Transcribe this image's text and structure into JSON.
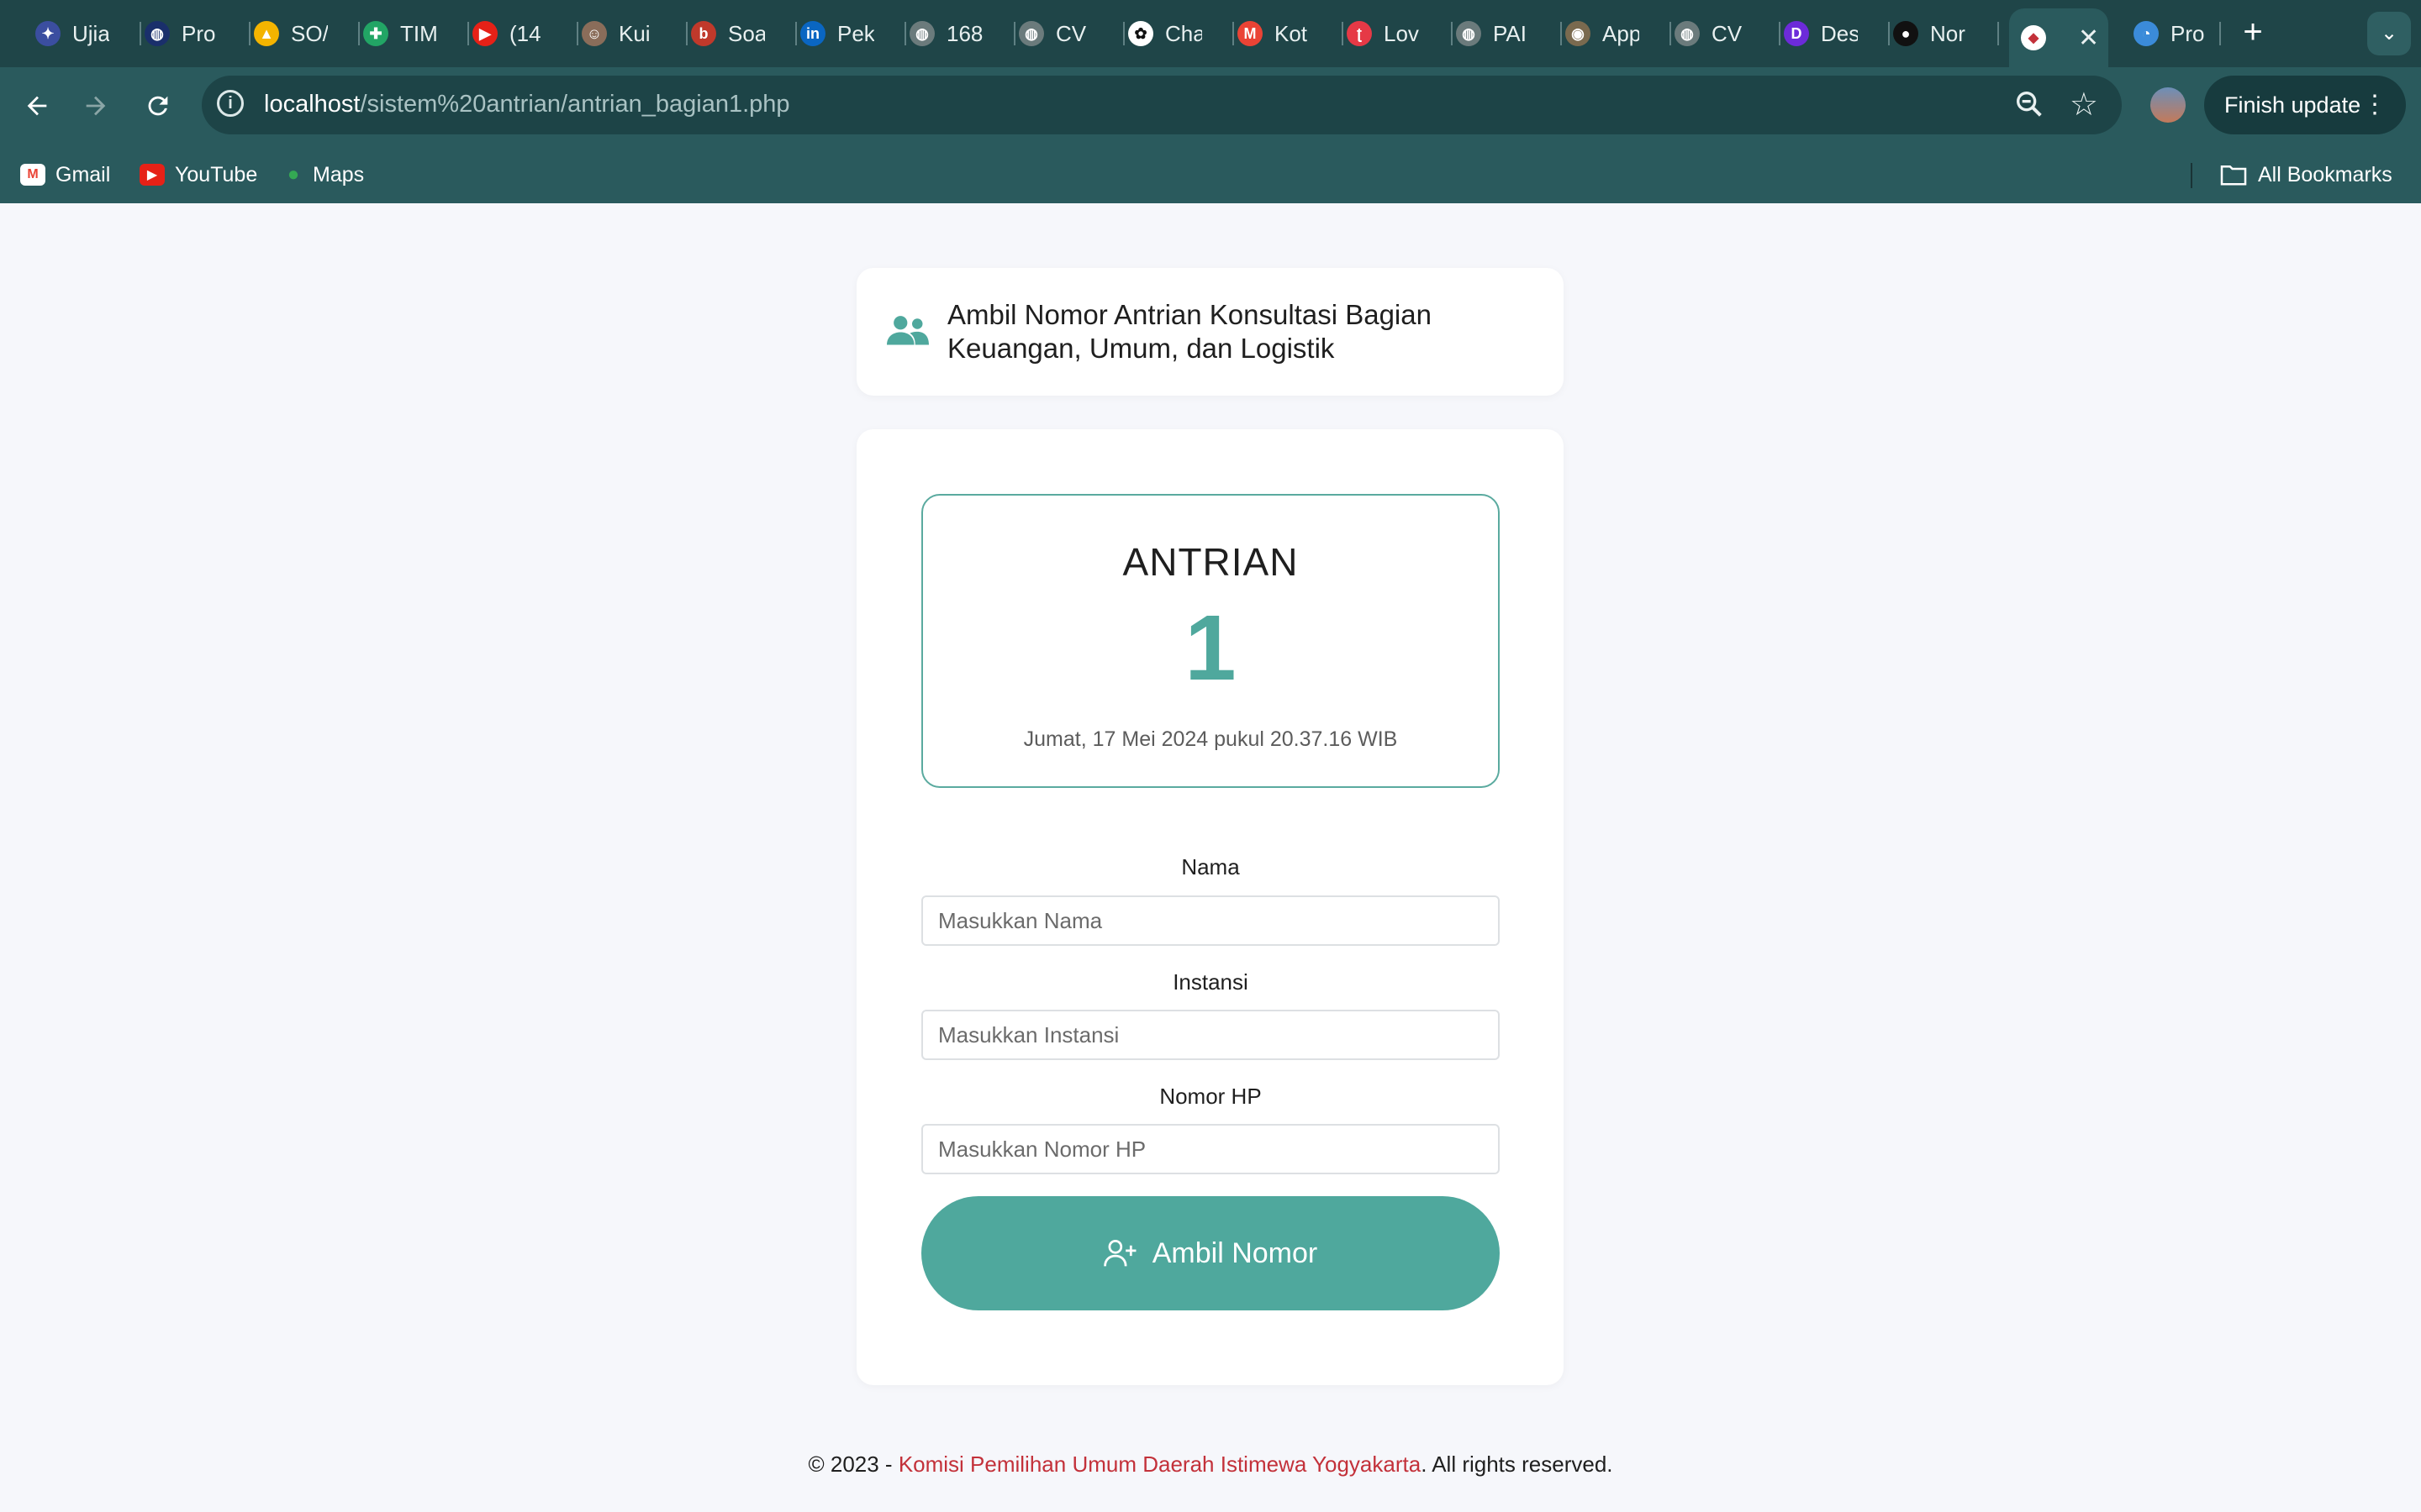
{
  "browser": {
    "tabs": [
      {
        "title": "Ujia",
        "icon": "university-icon",
        "color": "#3b4ea0"
      },
      {
        "title": "Pro",
        "icon": "globe-icon",
        "color": "#1a2f6b"
      },
      {
        "title": "SO/",
        "icon": "drive-icon",
        "color": "#f4b400"
      },
      {
        "title": "TIM",
        "icon": "sheets-icon",
        "color": "#22a565"
      },
      {
        "title": "(14",
        "icon": "youtube-icon",
        "color": "#e62117"
      },
      {
        "title": "Kui",
        "icon": "quiz-icon",
        "color": "#8a6d5a"
      },
      {
        "title": "Soa",
        "icon": "bb-icon",
        "color": "#c0392b"
      },
      {
        "title": "Pek",
        "icon": "linkedin-icon",
        "color": "#0a66c2"
      },
      {
        "title": "168",
        "icon": "globe-icon",
        "color": "#6b7b7c"
      },
      {
        "title": "CV",
        "icon": "globe-icon",
        "color": "#6b7b7c"
      },
      {
        "title": "Cha",
        "icon": "chatgpt-icon",
        "color": "#ffffff"
      },
      {
        "title": "Kot",
        "icon": "gmail-icon",
        "color": "#ea4335"
      },
      {
        "title": "Lov",
        "icon": "tinder-icon",
        "color": "#e63946"
      },
      {
        "title": "PAI",
        "icon": "globe-icon",
        "color": "#6b7b7c"
      },
      {
        "title": "App",
        "icon": "seal-icon",
        "color": "#7a6a4f"
      },
      {
        "title": "CV",
        "icon": "globe-icon",
        "color": "#6b7b7c"
      },
      {
        "title": "Des",
        "icon": "dealls-icon",
        "color": "#6c2bd9"
      },
      {
        "title": "Nor",
        "icon": "record-icon",
        "color": "#111111"
      }
    ],
    "active_tab": {
      "icon": "kpu-icon",
      "close": "✕"
    },
    "after_tab": {
      "title": "Pro",
      "icon": "drive-icon"
    },
    "new_tab": "+",
    "url_host": "localhost",
    "url_path": "/sistem%20antrian/antrian_bagian1.php",
    "finish_update": "Finish update",
    "bookmarks": [
      {
        "label": "Gmail",
        "icon": "gmail-icon"
      },
      {
        "label": "YouTube",
        "icon": "youtube-icon"
      },
      {
        "label": "Maps",
        "icon": "maps-pin-icon"
      }
    ],
    "all_bookmarks": "All Bookmarks"
  },
  "page": {
    "header_title": "Ambil Nomor Antrian Konsultasi Bagian Keuangan, Umum, dan Logistik",
    "queue_label": "ANTRIAN",
    "queue_number": "1",
    "timestamp": "Jumat, 17 Mei 2024 pukul 20.37.16 WIB",
    "form": {
      "name_label": "Nama",
      "name_placeholder": "Masukkan Nama",
      "name_value": "",
      "instansi_label": "Instansi",
      "instansi_placeholder": "Masukkan Instansi",
      "instansi_value": "",
      "phone_label": "Nomor HP",
      "phone_placeholder": "Masukkan Nomor HP",
      "phone_value": "",
      "submit_label": "Ambil Nomor"
    },
    "footer": {
      "prefix": "© 2023 - ",
      "org": "Komisi Pemilihan Umum Daerah Istimewa Yogyakarta",
      "suffix": ". All rights reserved."
    },
    "accent_color": "#4fa89d"
  }
}
